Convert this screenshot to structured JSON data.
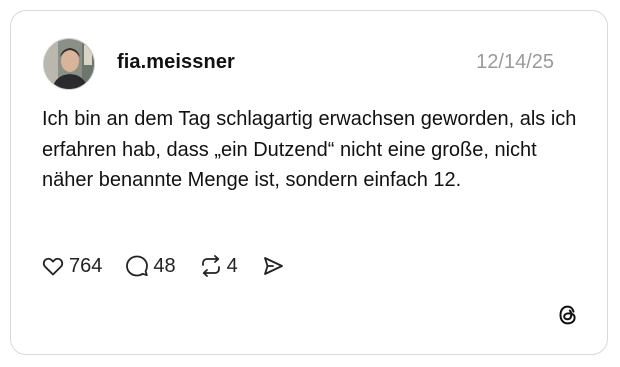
{
  "post": {
    "username": "fia.meissner",
    "date": "12/14/25",
    "text": "Ich bin an dem Tag schlagartig erwachsen geworden, als ich erfahren hab, dass „ein Dutzend“ nicht eine große, nicht näher benannte Menge ist, sondern einfach 12."
  },
  "actions": {
    "likes": "764",
    "replies": "48",
    "reposts": "4"
  },
  "icons": {
    "like": "heart-icon",
    "reply": "speech-bubble-icon",
    "repost": "repost-arrows-icon",
    "share": "paper-plane-icon",
    "brand": "threads-logo-icon"
  },
  "colors": {
    "text": "#111111",
    "muted": "#9a9a9a",
    "border": "#d9d9d9"
  }
}
